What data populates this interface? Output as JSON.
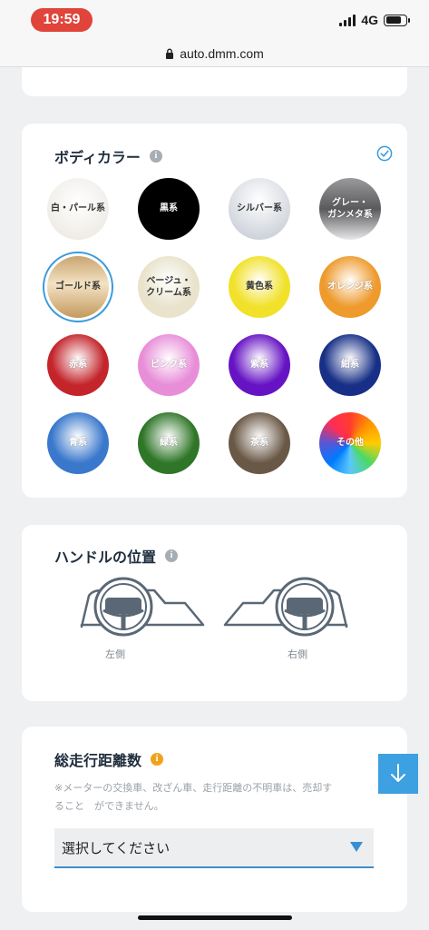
{
  "status": {
    "time": "19:59",
    "network": "4G",
    "battery_level": 0.8
  },
  "browser": {
    "url": "auto.dmm.com"
  },
  "body_color": {
    "title": "ボディカラー",
    "options": [
      {
        "label": "白・パール系",
        "color": "#f5f2ee",
        "selected": false
      },
      {
        "label": "黒系",
        "color": "#000000",
        "selected": false
      },
      {
        "label": "シルバー系",
        "color": "#d8dbe1",
        "selected": false
      },
      {
        "label": "グレー・\nガンメタ系",
        "color": "#6b6b6e",
        "selected": false
      },
      {
        "label": "ゴールド系",
        "color": "#c8a874",
        "selected": true
      },
      {
        "label": "ベージュ・\nクリーム系",
        "color": "#e9e3cc",
        "selected": false
      },
      {
        "label": "黄色系",
        "color": "#f1e12a",
        "selected": false
      },
      {
        "label": "オレンジ系",
        "color": "#ee9a2c",
        "selected": false
      },
      {
        "label": "赤系",
        "color": "#c3252b",
        "selected": false
      },
      {
        "label": "ピンク系",
        "color": "#e88ed8",
        "selected": false
      },
      {
        "label": "紫系",
        "color": "#6613c4",
        "selected": false
      },
      {
        "label": "紺系",
        "color": "#172f86",
        "selected": false
      },
      {
        "label": "青系",
        "color": "#3a78cc",
        "selected": false
      },
      {
        "label": "緑系",
        "color": "#2f7628",
        "selected": false
      },
      {
        "label": "茶系",
        "color": "#6a5846",
        "selected": false
      },
      {
        "label": "その他",
        "color": "multicolor",
        "selected": false
      }
    ]
  },
  "handle": {
    "title": "ハンドルの位置",
    "left_label": "左側",
    "right_label": "右側"
  },
  "mileage": {
    "title": "総走行距離数",
    "note_line1": "※メーターの交換車、改ざん車、走行距離の不明車は、売却す",
    "note_line2": "ること　ができません。",
    "select_placeholder": "選択してください"
  }
}
